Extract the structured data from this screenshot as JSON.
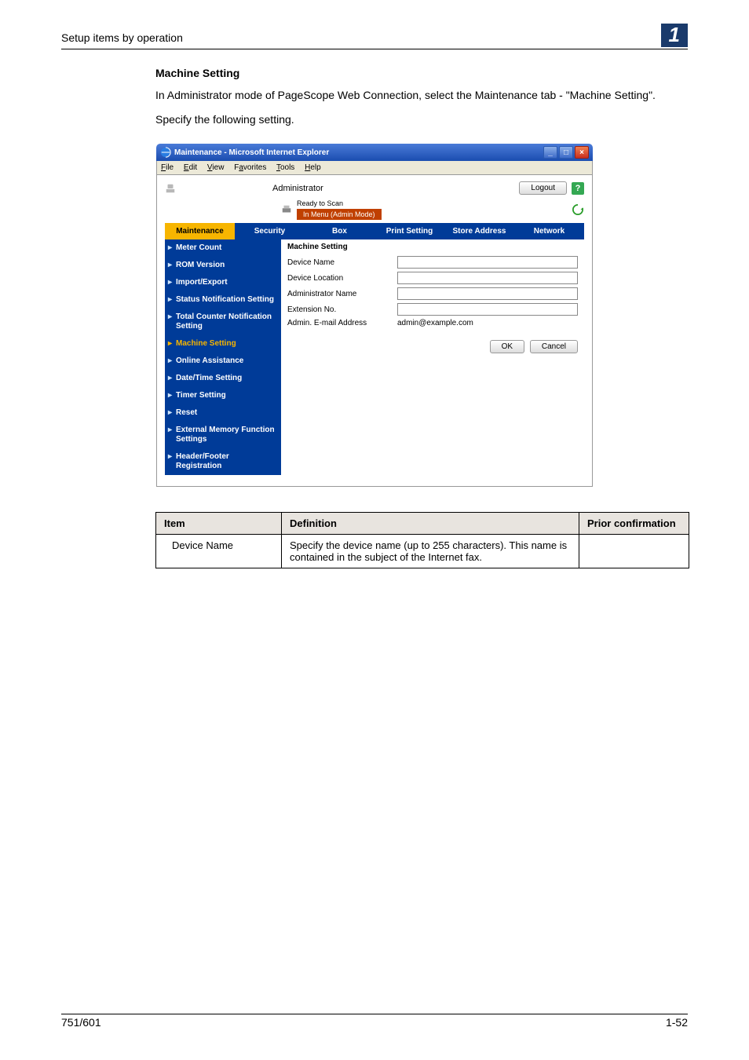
{
  "page_header": {
    "running": "Setup items by operation",
    "chapter": "1"
  },
  "footer": {
    "left": "751/601",
    "right": "1-52"
  },
  "content": {
    "heading": "Machine Setting",
    "para1": "In Administrator mode of PageScope Web Connection, select the Maintenance tab - \"Machine Setting\".",
    "para2": "Specify the following setting."
  },
  "ie": {
    "title": "Maintenance - Microsoft Internet Explorer",
    "menu": [
      "File",
      "Edit",
      "View",
      "Favorites",
      "Tools",
      "Help"
    ]
  },
  "psc": {
    "administrator": "Administrator",
    "logout": "Logout",
    "status_ready": "Ready to Scan",
    "status_mode": "In Menu (Admin Mode)",
    "tabs": [
      "Maintenance",
      "Security",
      "Box",
      "Print Setting",
      "Store Address",
      "Network"
    ],
    "active_tab": 0,
    "sidebar": [
      "Meter Count",
      "ROM Version",
      "Import/Export",
      "Status Notification Setting",
      "Total Counter Notification Setting",
      "Machine Setting",
      "Online Assistance",
      "Date/Time Setting",
      "Timer Setting",
      "Reset",
      "External Memory Function Settings",
      "Header/Footer Registration"
    ],
    "selected_sidebar": 5,
    "panel_title": "Machine Setting",
    "form": {
      "device_name": {
        "label": "Device Name",
        "value": ""
      },
      "device_location": {
        "label": "Device Location",
        "value": ""
      },
      "admin_name": {
        "label": "Administrator Name",
        "value": ""
      },
      "extension": {
        "label": "Extension No.",
        "value": ""
      },
      "admin_email": {
        "label": "Admin. E-mail Address",
        "value": "admin@example.com"
      }
    },
    "ok": "OK",
    "cancel": "Cancel"
  },
  "def_table": {
    "headers": [
      "Item",
      "Definition",
      "Prior confirmation"
    ],
    "rows": [
      {
        "item": "Device Name",
        "def": "Specify the device name (up to 255 characters). This name is contained in the subject of the Internet fax.",
        "prior": ""
      }
    ]
  }
}
